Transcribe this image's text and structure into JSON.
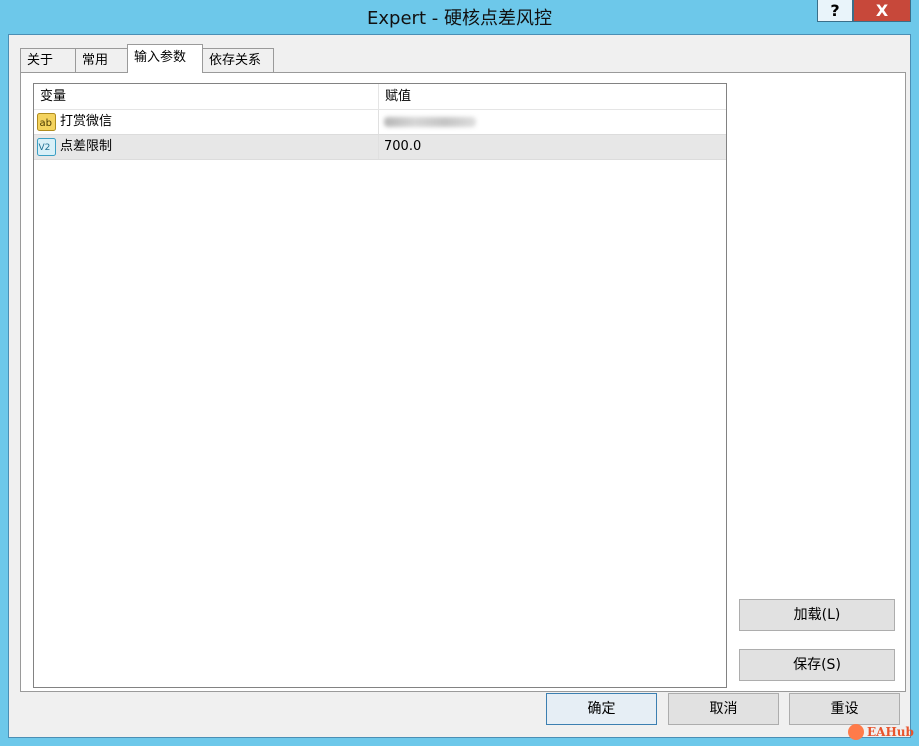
{
  "window": {
    "title": "Expert - 硬核点差风控",
    "help_label": "?",
    "close_label": "X"
  },
  "tabs": [
    {
      "label": "关于",
      "active": false
    },
    {
      "label": "常用",
      "active": false
    },
    {
      "label": "输入参数",
      "active": true
    },
    {
      "label": "依存关系",
      "active": false
    }
  ],
  "params": {
    "columns": [
      "变量",
      "赋值"
    ],
    "rows": [
      {
        "icon": "string-ab-icon",
        "name": "打赏微信",
        "value": "",
        "value_obscured": true
      },
      {
        "icon": "double-value-icon",
        "name": "点差限制",
        "value": "700.0",
        "value_obscured": false
      }
    ]
  },
  "side_buttons": {
    "load": "加载(L)",
    "save": "保存(S)"
  },
  "footer_buttons": {
    "ok": "确定",
    "cancel": "取消",
    "reset": "重设"
  },
  "watermark": {
    "text": "EAHub"
  },
  "colors": {
    "titlebar": "#6dc8ea",
    "close": "#c7483a",
    "selected_row": "#e7e7e7"
  }
}
